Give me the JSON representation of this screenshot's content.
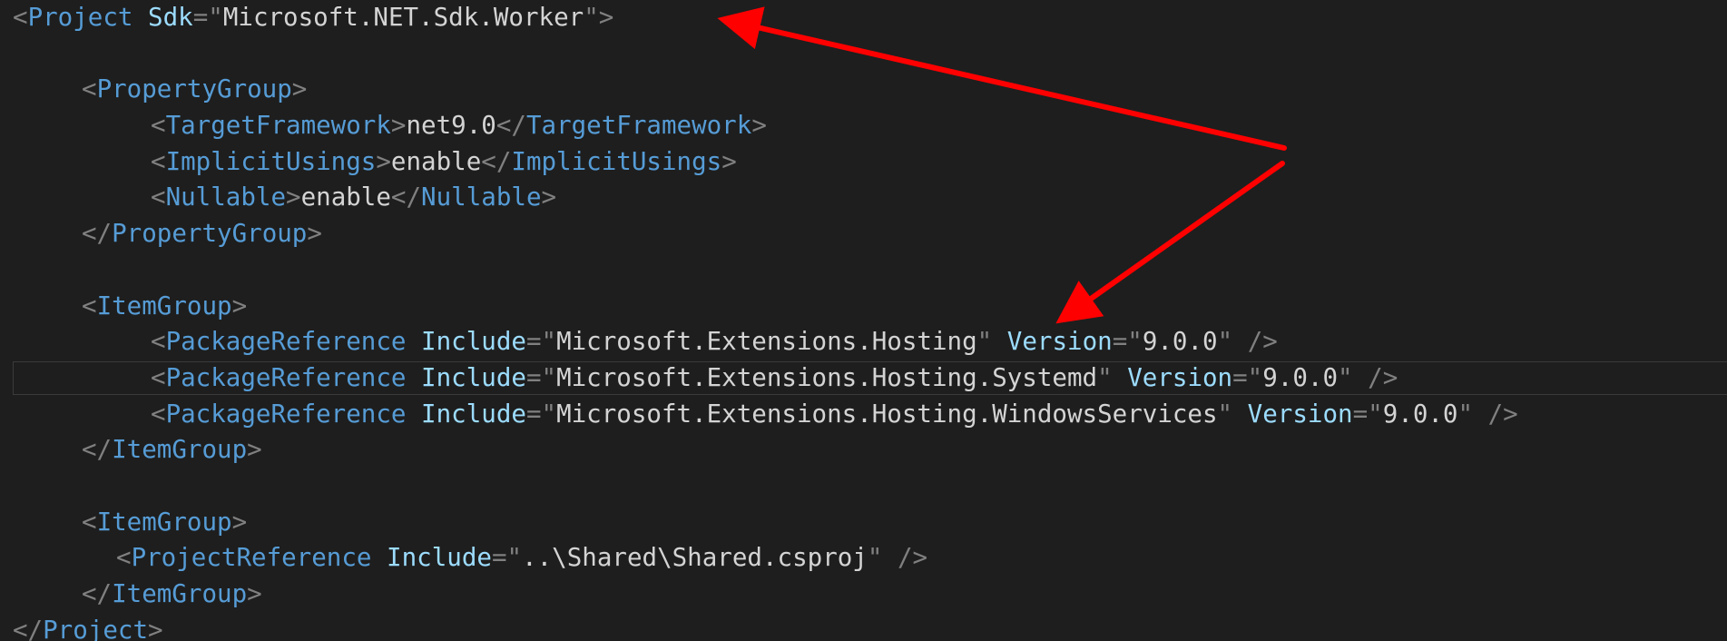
{
  "editor": {
    "lines": [
      {
        "parts": [
          {
            "c": "p",
            "t": "<"
          },
          {
            "c": "t",
            "t": "Project"
          },
          {
            "c": "v",
            "t": " "
          },
          {
            "c": "a",
            "t": "Sdk"
          },
          {
            "c": "p",
            "t": "=\""
          },
          {
            "c": "v",
            "t": "Microsoft.NET.Sdk.Worker"
          },
          {
            "c": "p",
            "t": "\">"
          }
        ]
      },
      {
        "parts": []
      },
      {
        "parts": [
          {
            "c": "i1",
            "t": ""
          },
          {
            "c": "p",
            "t": "<"
          },
          {
            "c": "t",
            "t": "PropertyGroup"
          },
          {
            "c": "p",
            "t": ">"
          }
        ]
      },
      {
        "parts": [
          {
            "c": "i2",
            "t": ""
          },
          {
            "c": "p",
            "t": "<"
          },
          {
            "c": "t",
            "t": "TargetFramework"
          },
          {
            "c": "p",
            "t": ">"
          },
          {
            "c": "v",
            "t": "net9.0"
          },
          {
            "c": "p",
            "t": "</"
          },
          {
            "c": "t",
            "t": "TargetFramework"
          },
          {
            "c": "p",
            "t": ">"
          }
        ]
      },
      {
        "parts": [
          {
            "c": "i2",
            "t": ""
          },
          {
            "c": "p",
            "t": "<"
          },
          {
            "c": "t",
            "t": "ImplicitUsings"
          },
          {
            "c": "p",
            "t": ">"
          },
          {
            "c": "v",
            "t": "enable"
          },
          {
            "c": "p",
            "t": "</"
          },
          {
            "c": "t",
            "t": "ImplicitUsings"
          },
          {
            "c": "p",
            "t": ">"
          }
        ]
      },
      {
        "parts": [
          {
            "c": "i2",
            "t": ""
          },
          {
            "c": "p",
            "t": "<"
          },
          {
            "c": "t",
            "t": "Nullable"
          },
          {
            "c": "p",
            "t": ">"
          },
          {
            "c": "v",
            "t": "enable"
          },
          {
            "c": "p",
            "t": "</"
          },
          {
            "c": "t",
            "t": "Nullable"
          },
          {
            "c": "p",
            "t": ">"
          }
        ]
      },
      {
        "parts": [
          {
            "c": "i1",
            "t": ""
          },
          {
            "c": "p",
            "t": "</"
          },
          {
            "c": "t",
            "t": "PropertyGroup"
          },
          {
            "c": "p",
            "t": ">"
          }
        ]
      },
      {
        "parts": []
      },
      {
        "parts": [
          {
            "c": "i1",
            "t": ""
          },
          {
            "c": "p",
            "t": "<"
          },
          {
            "c": "t",
            "t": "ItemGroup"
          },
          {
            "c": "p",
            "t": ">"
          }
        ]
      },
      {
        "parts": [
          {
            "c": "i2",
            "t": ""
          },
          {
            "c": "p",
            "t": "<"
          },
          {
            "c": "t",
            "t": "PackageReference"
          },
          {
            "c": "v",
            "t": " "
          },
          {
            "c": "a",
            "t": "Include"
          },
          {
            "c": "p",
            "t": "=\""
          },
          {
            "c": "v",
            "t": "Microsoft.Extensions.Hosting"
          },
          {
            "c": "p",
            "t": "\""
          },
          {
            "c": "v",
            "t": " "
          },
          {
            "c": "a",
            "t": "Version"
          },
          {
            "c": "p",
            "t": "=\""
          },
          {
            "c": "v",
            "t": "9.0.0"
          },
          {
            "c": "p",
            "t": "\" />"
          }
        ]
      },
      {
        "parts": [
          {
            "c": "i2",
            "t": ""
          },
          {
            "c": "p",
            "t": "<"
          },
          {
            "c": "t",
            "t": "PackageReference"
          },
          {
            "c": "v",
            "t": " "
          },
          {
            "c": "a",
            "t": "Include"
          },
          {
            "c": "p",
            "t": "=\""
          },
          {
            "c": "v",
            "t": "Microsoft.Extensions.Hosting.Systemd"
          },
          {
            "c": "p",
            "t": "\""
          },
          {
            "c": "v",
            "t": " "
          },
          {
            "c": "a",
            "t": "Version"
          },
          {
            "c": "p",
            "t": "=\""
          },
          {
            "c": "v",
            "t": "9.0.0"
          },
          {
            "c": "p",
            "t": "\" />"
          }
        ]
      },
      {
        "parts": [
          {
            "c": "i2",
            "t": ""
          },
          {
            "c": "p",
            "t": "<"
          },
          {
            "c": "t",
            "t": "PackageReference"
          },
          {
            "c": "v",
            "t": " "
          },
          {
            "c": "a",
            "t": "Include"
          },
          {
            "c": "p",
            "t": "=\""
          },
          {
            "c": "v",
            "t": "Microsoft.Extensions.Hosting.WindowsServices"
          },
          {
            "c": "p",
            "t": "\""
          },
          {
            "c": "v",
            "t": " "
          },
          {
            "c": "a",
            "t": "Version"
          },
          {
            "c": "p",
            "t": "=\""
          },
          {
            "c": "v",
            "t": "9.0.0"
          },
          {
            "c": "p",
            "t": "\" />"
          }
        ]
      },
      {
        "parts": [
          {
            "c": "i1",
            "t": ""
          },
          {
            "c": "p",
            "t": "</"
          },
          {
            "c": "t",
            "t": "ItemGroup"
          },
          {
            "c": "p",
            "t": ">"
          }
        ]
      },
      {
        "parts": []
      },
      {
        "parts": [
          {
            "c": "i1",
            "t": ""
          },
          {
            "c": "p",
            "t": "<"
          },
          {
            "c": "t",
            "t": "ItemGroup"
          },
          {
            "c": "p",
            "t": ">"
          }
        ]
      },
      {
        "parts": [
          {
            "c": "i15",
            "t": ""
          },
          {
            "c": "p",
            "t": "<"
          },
          {
            "c": "t",
            "t": "ProjectReference"
          },
          {
            "c": "v",
            "t": " "
          },
          {
            "c": "a",
            "t": "Include"
          },
          {
            "c": "p",
            "t": "=\""
          },
          {
            "c": "v",
            "t": "..\\Shared\\Shared.csproj"
          },
          {
            "c": "p",
            "t": "\" />"
          }
        ]
      },
      {
        "parts": [
          {
            "c": "i1",
            "t": ""
          },
          {
            "c": "p",
            "t": "</"
          },
          {
            "c": "t",
            "t": "ItemGroup"
          },
          {
            "c": "p",
            "t": ">"
          }
        ]
      },
      {
        "parts": [
          {
            "c": "p",
            "t": "</"
          },
          {
            "c": "t",
            "t": "Project"
          },
          {
            "c": "p",
            "t": ">"
          }
        ]
      }
    ]
  },
  "colors": {
    "background": "#1e1e1e",
    "punctuation": "#808080",
    "tag": "#569cd6",
    "attribute": "#9cdcfe",
    "value": "#d4d4d4",
    "annotation_arrow": "#ff0000"
  },
  "annotations": {
    "arrow_icon": "red-callout-arrows",
    "count": 2
  }
}
